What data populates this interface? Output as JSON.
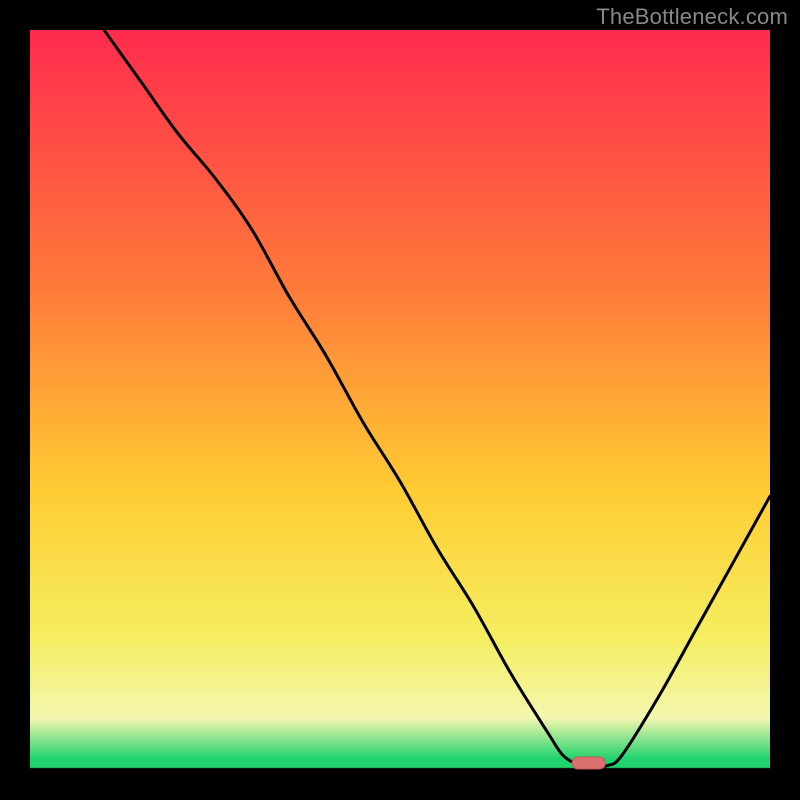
{
  "watermark": "TheBottleneck.com",
  "colors": {
    "axis": "#000000",
    "curve": "#000000",
    "marker_fill": "#da6f6f",
    "marker_stroke": "#c65a5a",
    "gradient_top": "#ff2b4e",
    "gradient_upper_mid": "#ff7b3a",
    "gradient_mid": "#ffcc33",
    "gradient_lower_mid": "#f5ee60",
    "gradient_pale": "#f4f7b0",
    "gradient_green": "#21d36e",
    "frame_bg": "#000000"
  },
  "chart_data": {
    "type": "line",
    "title": "",
    "xlabel": "",
    "ylabel": "",
    "xlim": [
      0,
      100
    ],
    "ylim": [
      0,
      100
    ],
    "x": [
      10,
      15,
      20,
      25,
      30,
      35,
      40,
      45,
      50,
      55,
      60,
      65,
      70,
      72,
      74,
      76,
      78,
      80,
      85,
      90,
      95,
      100
    ],
    "values": [
      100,
      93,
      86,
      80,
      73,
      64,
      56,
      47,
      39,
      30,
      22,
      13,
      5,
      2,
      0.8,
      0.5,
      0.6,
      2,
      10,
      19,
      28,
      37
    ],
    "minimum_marker": {
      "x": 75.5,
      "y": 0.5,
      "width_x": 4.5
    },
    "gradient_stops": [
      {
        "pos": 0.0,
        "key": "gradient_top"
      },
      {
        "pos": 0.35,
        "key": "gradient_upper_mid"
      },
      {
        "pos": 0.62,
        "key": "gradient_mid"
      },
      {
        "pos": 0.82,
        "key": "gradient_lower_mid"
      },
      {
        "pos": 0.93,
        "key": "gradient_pale"
      },
      {
        "pos": 0.985,
        "key": "gradient_green"
      },
      {
        "pos": 1.0,
        "key": "gradient_green"
      }
    ]
  }
}
